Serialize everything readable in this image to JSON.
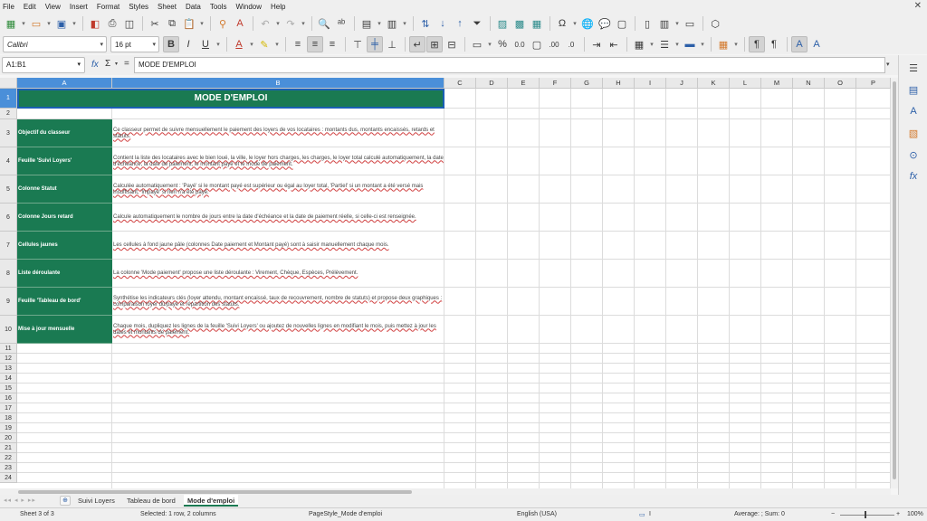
{
  "menu": [
    "File",
    "Edit",
    "View",
    "Insert",
    "Format",
    "Styles",
    "Sheet",
    "Data",
    "Tools",
    "Window",
    "Help"
  ],
  "window_close": "✕",
  "font": {
    "name": "Calibri",
    "size": "16 pt"
  },
  "namebox": "A1:B1",
  "formula": "MODE D'EMPLOI",
  "columns": [
    "A",
    "B",
    "C",
    "D",
    "E",
    "F",
    "G",
    "H",
    "I",
    "J",
    "K",
    "L",
    "M",
    "N",
    "O",
    "P"
  ],
  "rows": [
    "1",
    "2",
    "3",
    "4",
    "5",
    "6",
    "7",
    "8",
    "9",
    "10",
    "11",
    "12",
    "13",
    "14",
    "15",
    "16",
    "17",
    "18",
    "19",
    "20",
    "21",
    "22",
    "23",
    "24"
  ],
  "sheet": {
    "title": "MODE D'EMPLOI",
    "entries": [
      {
        "label": "Objectif du classeur",
        "text": "Ce classeur permet de suivre mensuellement le paiement des loyers de vos locataires : montants dus, montants encaissés, retards et statuts."
      },
      {
        "label": "Feuille 'Suivi Loyers'",
        "text": "Contient la liste des locataires avec le bien loué, la ville, le loyer hors charges, les charges, le loyer total calculé automatiquement, la date d'échéance, la date de paiement, le montant payé et le mode de paiement."
      },
      {
        "label": "Colonne Statut",
        "text": "Calculée automatiquement : 'Payé' si le montant payé est supérieur ou égal au loyer total, 'Partiel' si un montant a été versé mais insuffisant, 'Impayé' si rien n'a été payé."
      },
      {
        "label": "Colonne Jours retard",
        "text": "Calcule automatiquement le nombre de jours entre la date d'échéance et la date de paiement réelle, si celle-ci est renseignée."
      },
      {
        "label": "Cellules jaunes",
        "text": "Les cellules à fond jaune pâle (colonnes Date paiement et Montant payé) sont à saisir manuellement chaque mois."
      },
      {
        "label": "Liste déroulante",
        "text": "La colonne 'Mode paiement' propose une liste déroulante : Virement, Chèque, Espèces, Prélèvement."
      },
      {
        "label": "Feuille 'Tableau de bord'",
        "text": "Synthétise les indicateurs clés (loyer attendu, montant encaissé, taux de recouvrement, nombre de statuts) et propose deux graphiques : comparaison loyer dû/payé et répartition des statuts."
      },
      {
        "label": "Mise à jour mensuelle",
        "text": "Chaque mois, dupliquez les lignes de la feuille 'Suivi Loyers' ou ajoutez de nouvelles lignes en modifiant le mois, puis mettez à jour les dates et montants de paiement."
      }
    ]
  },
  "tabs": {
    "add": "⊕",
    "sheets": [
      "Suivi Loyers",
      "Tableau de bord",
      "Mode d'emploi"
    ],
    "active_index": 2
  },
  "status": {
    "sheet": "Sheet 3 of 3",
    "selection": "Selected: 1 row, 2 columns",
    "pagestyle": "PageStyle_Mode d'emploi",
    "language": "English (USA)",
    "summary": "Average: ; Sum: 0",
    "zoom_minus": "−",
    "zoom_plus": "+",
    "zoom": "100%"
  },
  "colors": {
    "header_green": "#1a7a52",
    "selection_blue": "#4a8fd9"
  }
}
